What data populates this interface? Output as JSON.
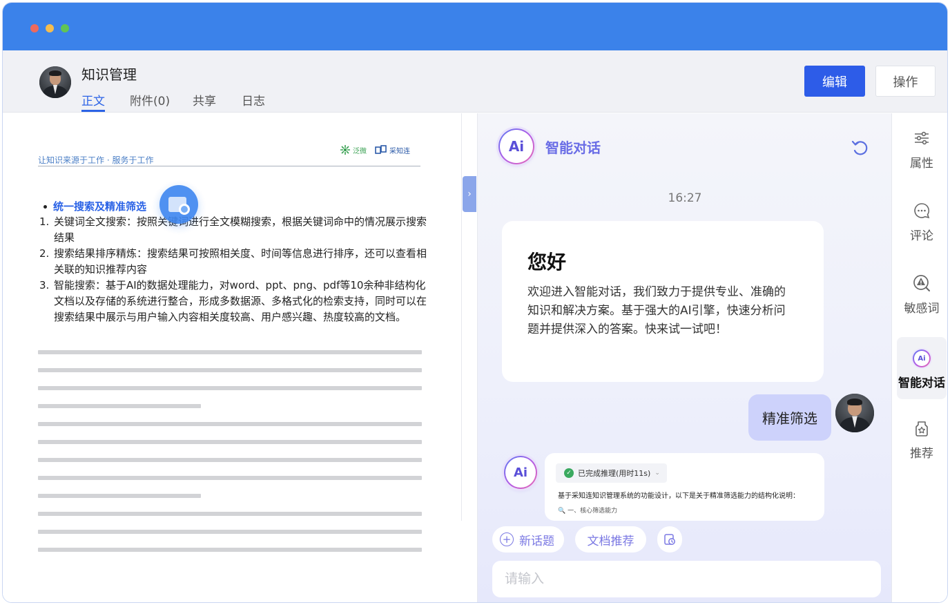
{
  "header": {
    "title": "知识管理",
    "tabs": [
      {
        "label": "正文",
        "active": true
      },
      {
        "label": "附件(0)",
        "active": false
      },
      {
        "label": "共享",
        "active": false
      },
      {
        "label": "日志",
        "active": false
      }
    ],
    "edit_label": "编辑",
    "ops_label": "操作"
  },
  "document": {
    "tagline": "让知识来源于工作 · 服务于工作",
    "logos": {
      "left": "泛微",
      "right": "采知连"
    },
    "heading": "统一搜索及精准筛选",
    "items": [
      {
        "num": "1.",
        "text": "关键词全文搜索：按照关键词进行全文模糊搜索，根据关键词命中的情况展示搜索结果"
      },
      {
        "num": "2.",
        "text": "搜索结果排序精炼：搜索结果可按照相关度、时间等信息进行排序，还可以查看相关联的知识推荐内容"
      },
      {
        "num": "3.",
        "text": "智能搜索：基于AI的数据处理能力，对word、ppt、png、pdf等10余种非结构化文档以及存储的系统进行整合，形成多数据源、多格式化的检索支持，同时可以在搜索结果中展示与用户输入内容相关度较高、用户感兴趣、热度较高的文档。"
      }
    ]
  },
  "chat": {
    "title": "智能对话",
    "ai_badge": "Ai",
    "timestamp": "16:27",
    "welcome_title": "您好",
    "welcome_body": "欢迎进入智能对话，我们致力于提供专业、准确的知识和解决方案。基于强大的AI引擎，快速分析问题并提供深入的答案。快来试一试吧！",
    "user_message": "精准筛选",
    "reasoning_status": "已完成推理(用时11s)",
    "reply_text": "基于采知连知识管理系统的功能设计，以下是关于精准筛选能力的结构化说明：",
    "reply_subhead": "🔍 一、核心筛选能力",
    "new_topic": "新话题",
    "doc_recommend": "文档推荐",
    "input_placeholder": "请输入"
  },
  "rail": [
    {
      "label": "属性",
      "icon": "sliders-icon",
      "active": false
    },
    {
      "label": "评论",
      "icon": "comment-icon",
      "active": false
    },
    {
      "label": "敏感词",
      "icon": "sensitive-word-icon",
      "active": false
    },
    {
      "label": "智能对话",
      "icon": "ai-chat-icon",
      "active": true
    },
    {
      "label": "推荐",
      "icon": "recommend-icon",
      "active": false
    }
  ],
  "colors": {
    "titlebar": "#3b82ea",
    "accent": "#2b63e6",
    "edit_button": "#2d5ce8",
    "ai_purple": "#6a6de6",
    "user_bubble": "#cdd2fb"
  }
}
